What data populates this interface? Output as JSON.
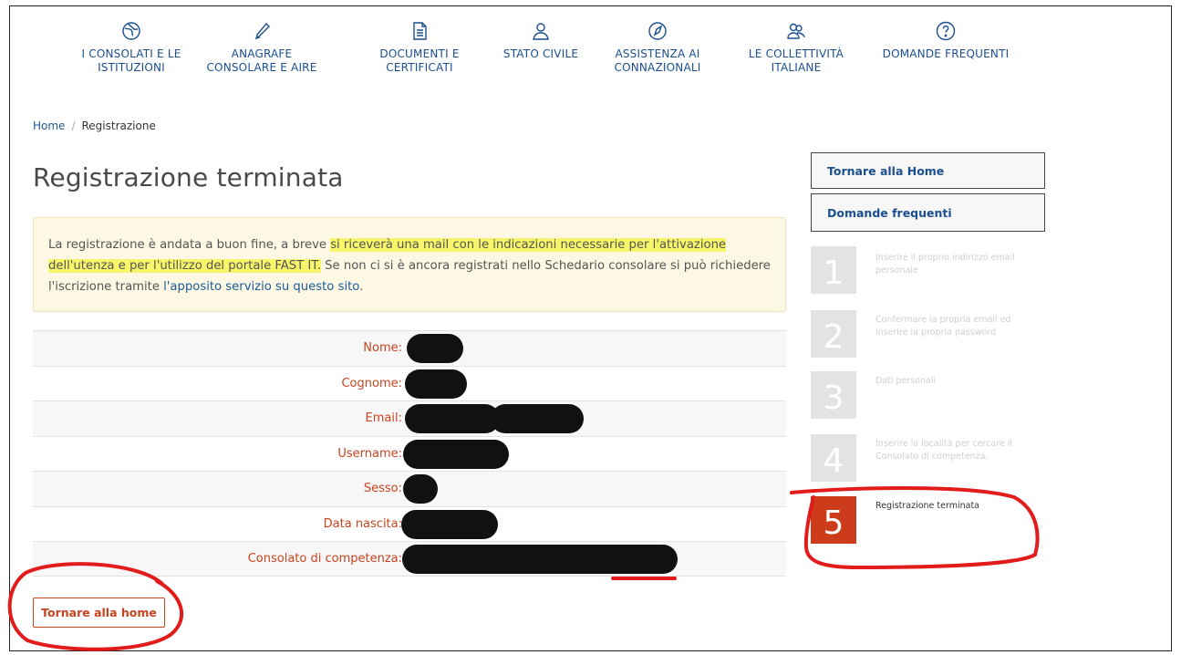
{
  "nav": {
    "items": [
      {
        "label_1": "I CONSOLATI E LE",
        "label_2": "ISTITUZIONI",
        "icon": "globe-icon"
      },
      {
        "label_1": "ANAGRAFE",
        "label_2": "CONSOLARE E AIRE",
        "icon": "pencil-icon"
      },
      {
        "label_1": "DOCUMENTI E",
        "label_2": "CERTIFICATI",
        "icon": "document-icon"
      },
      {
        "label_1": "STATO CIVILE",
        "label_2": "",
        "icon": "person-icon"
      },
      {
        "label_1": "ASSISTENZA AI",
        "label_2": "CONNAZIONALI",
        "icon": "compass-icon"
      },
      {
        "label_1": "LE COLLETTIVITÀ",
        "label_2": "ITALIANE",
        "icon": "people-icon"
      },
      {
        "label_1": "DOMANDE FREQUENTI",
        "label_2": "",
        "icon": "question-icon"
      }
    ]
  },
  "breadcrumb": {
    "home": "Home",
    "current": "Registrazione"
  },
  "page_title": "Registrazione terminata",
  "alert": {
    "part1": "La registrazione è andata a buon fine, a breve ",
    "highlight1": "si riceverà una mail con le indicazioni necessarie per l'attivazione",
    "highlight2": "dell'utenza e per l'utilizzo del portale FAST IT.",
    "part2": " Se non ci si è ancora registrati nello Schedario consolare si può richiedere l'iscrizione tramite ",
    "link": "l'apposito servizio su questo sito",
    "end": "."
  },
  "details": {
    "rows": [
      {
        "label": "Nome:"
      },
      {
        "label": "Cognome:"
      },
      {
        "label": "Email:"
      },
      {
        "label": "Username:"
      },
      {
        "label": "Sesso:"
      },
      {
        "label": "Data nascita:"
      },
      {
        "label": "Consolato di competenza:"
      }
    ]
  },
  "buttons": {
    "home_bottom": "Tornare alla home"
  },
  "sidebar": {
    "home_button": "Tornare alla Home",
    "faq_button": "Domande frequenti",
    "steps": [
      {
        "num": "1",
        "text": "Inserire il proprio indirizzo email personale"
      },
      {
        "num": "2",
        "text": "Confermare la propria email ed inserire la propria password"
      },
      {
        "num": "3",
        "text": "Dati personali"
      },
      {
        "num": "4",
        "text": "Inserire la località per cercare il Consolato di competenza."
      },
      {
        "num": "5",
        "text": "Registrazione terminata"
      }
    ]
  },
  "colors": {
    "nav_blue": "#1b4f8f",
    "label_red": "#c8431f",
    "active_step": "#cc3c1b",
    "highlight": "#f7f56a",
    "annotation_red": "#e21b1b"
  }
}
